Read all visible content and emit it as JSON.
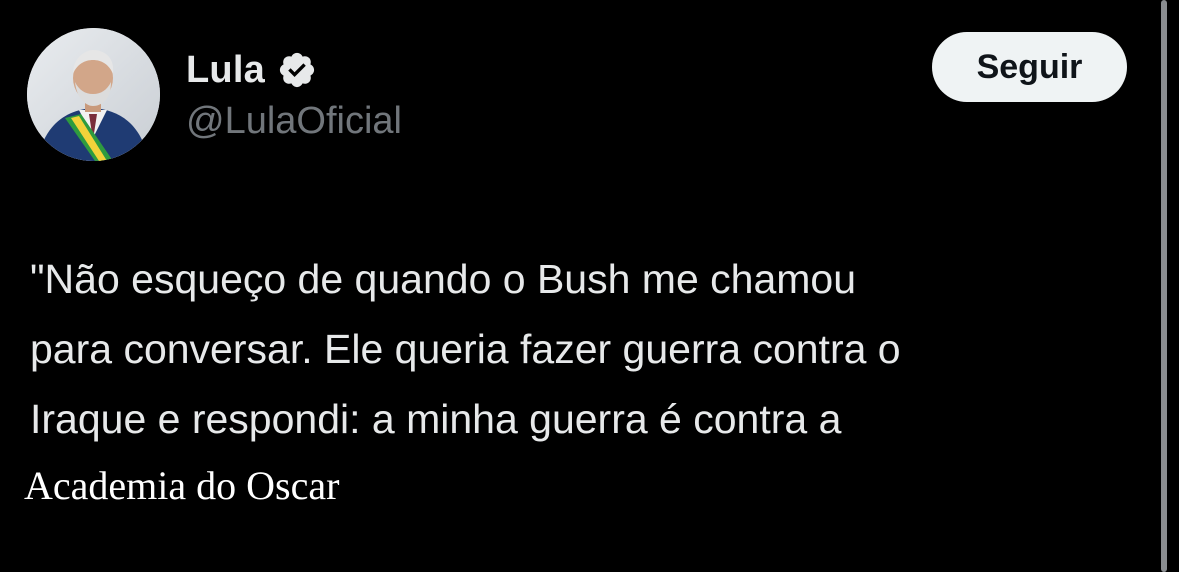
{
  "profile": {
    "name": "Lula",
    "handle": "@LulaOficial",
    "avatar_icon": "profile-photo",
    "verified_icon": "verified-badge-icon"
  },
  "actions": {
    "follow_label": "Seguir"
  },
  "tweet": {
    "lines": [
      "\"Não esqueço de quando o Bush me chamou",
      "para conversar. Ele queria fazer guerra contra o",
      "Iraque e respondi: a minha guerra é contra a"
    ]
  },
  "caption": "Academia do Oscar",
  "colors": {
    "background": "#000000",
    "text": "#e7e9ea",
    "secondary_text": "#71767b",
    "button_bg": "#eff3f4",
    "button_text": "#0f1419"
  }
}
